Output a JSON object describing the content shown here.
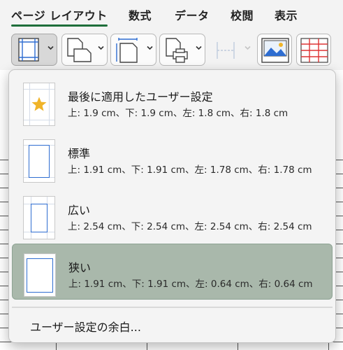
{
  "tabs": [
    {
      "label": "ページ レイアウト",
      "active": true
    },
    {
      "label": "数式",
      "active": false
    },
    {
      "label": "データ",
      "active": false
    },
    {
      "label": "校閲",
      "active": false
    },
    {
      "label": "表示",
      "active": false
    }
  ],
  "toolbar": {
    "buttons": [
      {
        "name": "margins-button",
        "icon": "margins-icon",
        "pressed": true
      },
      {
        "name": "orientation-button",
        "icon": "orientation-icon",
        "pressed": false
      },
      {
        "name": "size-button",
        "icon": "page-size-icon",
        "pressed": false
      },
      {
        "name": "print-area-button",
        "icon": "print-area-icon",
        "pressed": false
      },
      {
        "name": "breaks-button",
        "icon": "breaks-icon",
        "pressed": false,
        "disabled": true
      },
      {
        "name": "background-button",
        "icon": "background-image-icon",
        "pressed": false
      },
      {
        "name": "print-titles-button",
        "icon": "print-titles-icon",
        "pressed": false
      }
    ]
  },
  "margins_menu": {
    "items": [
      {
        "title": "最後に適用したユーザー設定",
        "desc": "上: 1.9 cm、下: 1.9 cm、左: 1.8 cm、右: 1.8 cm",
        "icon": "star-icon",
        "selected": false
      },
      {
        "title": "標準",
        "desc": "上: 1.91 cm、下: 1.91 cm、左: 1.78 cm、右: 1.78 cm",
        "selected": false
      },
      {
        "title": "広い",
        "desc": "上: 2.54 cm、下: 2.54 cm、左: 2.54 cm、右: 2.54 cm",
        "selected": false
      },
      {
        "title": "狭い",
        "desc": "上: 1.91 cm、下: 1.91 cm、左: 0.64 cm、右: 0.64 cm",
        "selected": true
      }
    ],
    "custom_label": "ユーザー設定の余白..."
  },
  "colors": {
    "accent": "#1e6e3a",
    "selected_bg": "#a9b8ab",
    "margin_line": "#2e6dd1",
    "star": "#f0b429"
  }
}
